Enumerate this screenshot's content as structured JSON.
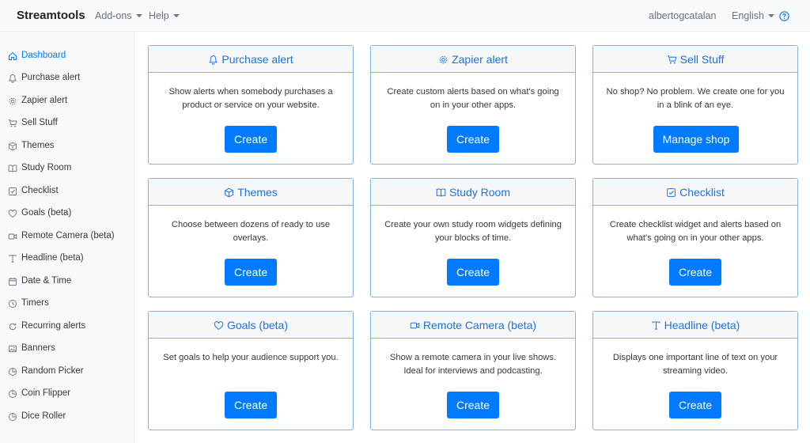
{
  "navbar": {
    "brand": "Streamtools",
    "addons": "Add-ons",
    "help": "Help",
    "user": "albertogcatalan",
    "language": "English"
  },
  "sidebar": {
    "items": [
      {
        "label": "Dashboard",
        "icon": "home-icon",
        "active": true
      },
      {
        "label": "Purchase alert",
        "icon": "bell-icon"
      },
      {
        "label": "Zapier alert",
        "icon": "gear-icon"
      },
      {
        "label": "Sell Stuff",
        "icon": "cart-icon"
      },
      {
        "label": "Themes",
        "icon": "box-icon"
      },
      {
        "label": "Study Room",
        "icon": "book-icon"
      },
      {
        "label": "Checklist",
        "icon": "checkbox-icon"
      },
      {
        "label": "Goals (beta)",
        "icon": "heart-icon"
      },
      {
        "label": "Remote Camera (beta)",
        "icon": "video-icon"
      },
      {
        "label": "Headline (beta)",
        "icon": "type-icon"
      },
      {
        "label": "Date & Time",
        "icon": "calendar-icon"
      },
      {
        "label": "Timers",
        "icon": "clock-icon"
      },
      {
        "label": "Recurring alerts",
        "icon": "refresh-icon"
      },
      {
        "label": "Banners",
        "icon": "image-icon"
      },
      {
        "label": "Random Picker",
        "icon": "pie-icon"
      },
      {
        "label": "Coin Flipper",
        "icon": "pie-icon"
      },
      {
        "label": "Dice Roller",
        "icon": "pie-icon"
      }
    ]
  },
  "cards": [
    {
      "title": "Purchase alert",
      "icon": "bell-icon",
      "desc": "Show alerts when somebody purchases a product or service on your website.",
      "button": "Create"
    },
    {
      "title": "Zapier alert",
      "icon": "gear-icon",
      "desc": "Create custom alerts based on what's going on in your other apps.",
      "button": "Create"
    },
    {
      "title": "Sell Stuff",
      "icon": "cart-icon",
      "desc": "No shop? No problem. We create one for you in a blink of an eye.",
      "button": "Manage shop"
    },
    {
      "title": "Themes",
      "icon": "box-icon",
      "desc": "Choose between dozens of ready to use overlays.",
      "button": "Create"
    },
    {
      "title": "Study Room",
      "icon": "book-icon",
      "desc": "Create your own study room widgets defining your blocks of time.",
      "button": "Create"
    },
    {
      "title": "Checklist",
      "icon": "checkbox-icon",
      "desc": "Create checklist widget and alerts based on what's going on in your other apps.",
      "button": "Create"
    },
    {
      "title": "Goals (beta)",
      "icon": "heart-icon",
      "desc": "Set goals to help your audience support you.",
      "button": "Create"
    },
    {
      "title": "Remote Camera (beta)",
      "icon": "video-icon",
      "desc": "Show a remote camera in your live shows. Ideal for interviews and podcasting.",
      "button": "Create"
    },
    {
      "title": "Headline (beta)",
      "icon": "type-icon",
      "desc": "Displays one important line of text on your streaming video.",
      "button": "Create"
    }
  ],
  "colors": {
    "accent": "#007bff",
    "title": "#1a73e8",
    "border": "#80b3ea"
  }
}
